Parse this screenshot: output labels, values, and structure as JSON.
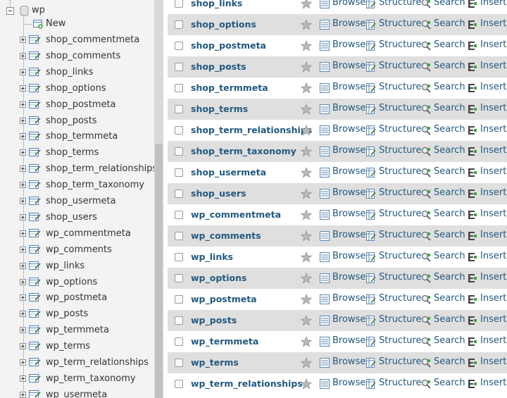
{
  "nav": {
    "database": "wp",
    "new_label": "New",
    "tables": [
      "shop_commentmeta",
      "shop_comments",
      "shop_links",
      "shop_options",
      "shop_postmeta",
      "shop_posts",
      "shop_termmeta",
      "shop_terms",
      "shop_term_relationships",
      "shop_term_taxonomy",
      "shop_usermeta",
      "shop_users",
      "wp_commentmeta",
      "wp_comments",
      "wp_links",
      "wp_options",
      "wp_postmeta",
      "wp_posts",
      "wp_termmeta",
      "wp_terms",
      "wp_term_relationships",
      "wp_term_taxonomy",
      "wp_usermeta"
    ]
  },
  "main": {
    "actions": {
      "browse": "Browse",
      "structure": "Structure",
      "search": "Search",
      "insert": "Insert"
    },
    "tables": [
      "shop_links",
      "shop_options",
      "shop_postmeta",
      "shop_posts",
      "shop_termmeta",
      "shop_terms",
      "shop_term_relationships",
      "shop_term_taxonomy",
      "shop_usermeta",
      "shop_users",
      "wp_commentmeta",
      "wp_comments",
      "wp_links",
      "wp_options",
      "wp_postmeta",
      "wp_posts",
      "wp_termmeta",
      "wp_terms",
      "wp_term_relationships"
    ]
  },
  "colors": {
    "link": "#235a81",
    "row_alt": "#dfdfdf",
    "nav_bg": "#f3f3f3",
    "star": "#b8b8b8"
  }
}
